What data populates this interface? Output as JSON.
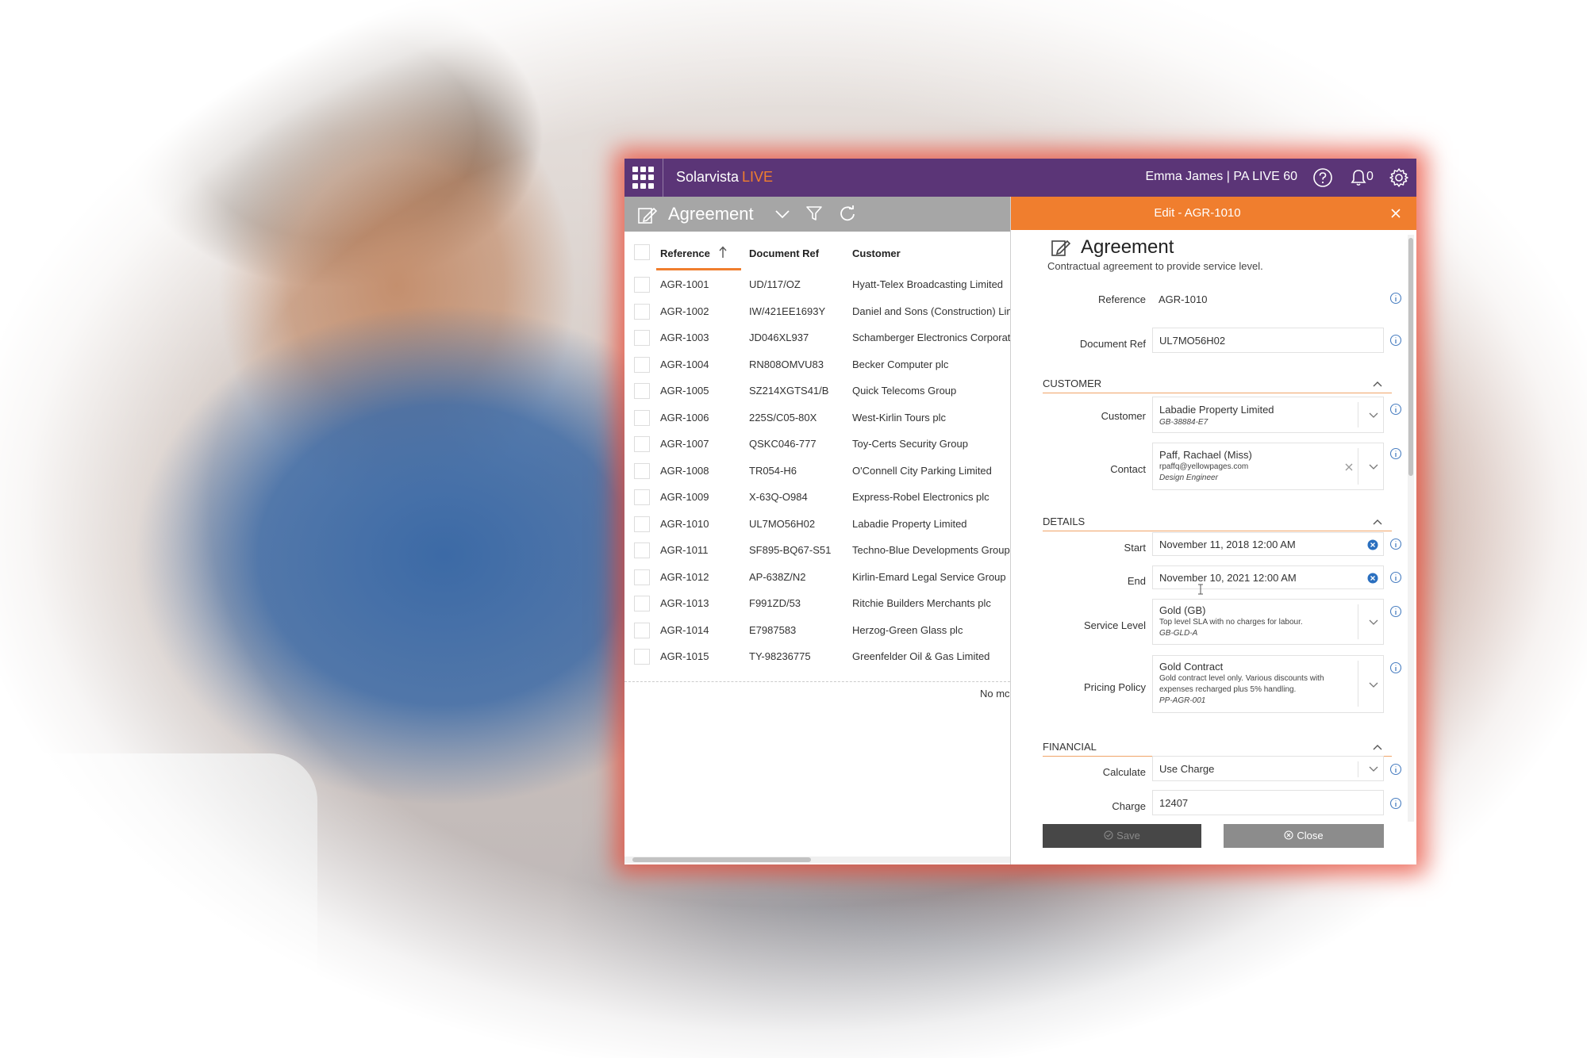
{
  "app": {
    "brand": "Solarvista",
    "brand_accent": "LIVE",
    "user": "Emma James  |  PA LIVE 60",
    "notification_count": "0",
    "colors": {
      "topbar": "#5b3577",
      "accent": "#f07e2e",
      "window_glow": "#eb4632"
    }
  },
  "list": {
    "title": "Agreement",
    "columns": [
      "Reference",
      "Document Ref",
      "Customer"
    ],
    "sort": {
      "column": "Reference",
      "direction": "ascending"
    },
    "rows": [
      [
        "AGR-1001",
        "UD/117/OZ",
        "Hyatt-Telex Broadcasting Limited"
      ],
      [
        "AGR-1002",
        "IW/421EE1693Y",
        "Daniel and Sons (Construction) Lim"
      ],
      [
        "AGR-1003",
        "JD046XL937",
        "Schamberger Electronics Corporat"
      ],
      [
        "AGR-1004",
        "RN808OMVU83",
        "Becker Computer plc"
      ],
      [
        "AGR-1005",
        "SZ214XGTS41/B",
        "Quick Telecoms Group"
      ],
      [
        "AGR-1006",
        "225S/C05-80X",
        "West-Kirlin Tours plc"
      ],
      [
        "AGR-1007",
        "QSKC046-777",
        "Toy-Certs Security Group"
      ],
      [
        "AGR-1008",
        "TR054-H6",
        "O'Connell City Parking Limited"
      ],
      [
        "AGR-1009",
        "X-63Q-O984",
        "Express-Robel Electronics plc"
      ],
      [
        "AGR-1010",
        "UL7MO56H02",
        "Labadie Property Limited"
      ],
      [
        "AGR-1011",
        "SF895-BQ67-S51",
        "Techno-Blue Developments Group"
      ],
      [
        "AGR-1012",
        "AP-638Z/N2",
        "Kirlin-Emard Legal Service Group"
      ],
      [
        "AGR-1013",
        "F991ZD/53",
        "Ritchie Builders Merchants plc"
      ],
      [
        "AGR-1014",
        "E7987583",
        "Herzog-Green Glass plc"
      ],
      [
        "AGR-1015",
        "TY-98236775",
        "Greenfelder Oil & Gas Limited"
      ]
    ],
    "footer_text": "No mc"
  },
  "edit": {
    "header_title": "Edit - AGR-1010",
    "form_title": "Agreement",
    "form_subtitle": "Contractual agreement to provide service level.",
    "reference": {
      "label": "Reference",
      "value": "AGR-1010"
    },
    "document_ref": {
      "label": "Document Ref",
      "value": "UL7MO56H02"
    },
    "customer_section": "CUSTOMER",
    "customer": {
      "label": "Customer",
      "value": "Labadie Property Limited",
      "code": "GB-38884-E7"
    },
    "contact": {
      "label": "Contact",
      "value": "Paff, Rachael (Miss)",
      "email": "rpaffq@yellowpages.com",
      "role": "Design Engineer"
    },
    "details_section": "DETAILS",
    "start": {
      "label": "Start",
      "value": "November 11, 2018 12:00 AM"
    },
    "end": {
      "label": "End",
      "value": "November 10, 2021 12:00 AM"
    },
    "service_level": {
      "label": "Service Level",
      "value": "Gold (GB)",
      "description": "Top level SLA with no charges for labour.",
      "code": "GB-GLD-A"
    },
    "pricing_policy": {
      "label": "Pricing Policy",
      "value": "Gold Contract",
      "description_line1": "Gold contract level only. Various discounts with",
      "description_line2": "expenses recharged plus 5% handling.",
      "code": "PP-AGR-001"
    },
    "financial_section": "FINANCIAL",
    "calculate": {
      "label": "Calculate",
      "value": "Use Charge"
    },
    "charge": {
      "label": "Charge",
      "value": "12407"
    },
    "save_label": "Save",
    "close_label": "Close"
  }
}
